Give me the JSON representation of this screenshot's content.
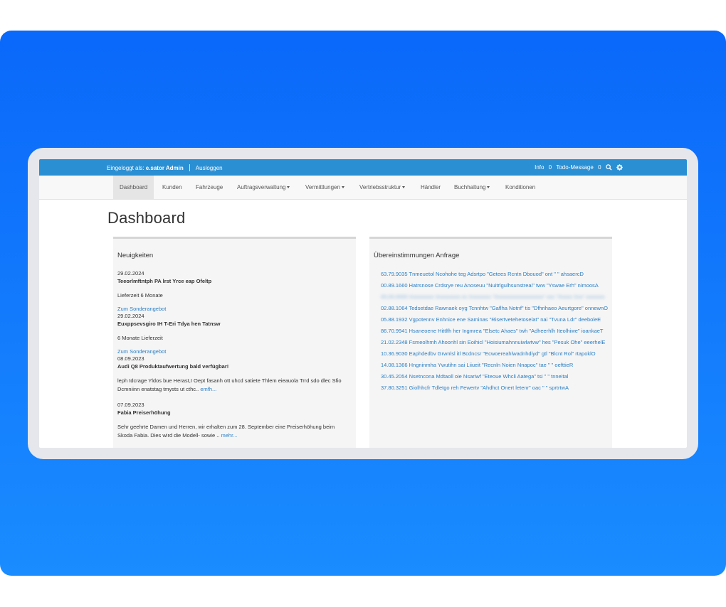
{
  "topbar": {
    "login_prefix": "Eingeloggt als:",
    "user": "e.sator Admin",
    "logout": "Ausloggen",
    "info_label": "Info",
    "info_count": "0",
    "todo_label": "Todo-Message",
    "todo_count": "0"
  },
  "nav": {
    "items": [
      {
        "label": "Dashboard"
      },
      {
        "label": "Kunden"
      },
      {
        "label": "Fahrzeuge"
      },
      {
        "label": "Auftragsverwaltung"
      },
      {
        "label": "Vermittlungen"
      },
      {
        "label": "Vertriebsstruktur"
      },
      {
        "label": "Händler"
      },
      {
        "label": "Buchhaltung"
      },
      {
        "label": "Konditionen"
      }
    ]
  },
  "page": {
    "title": "Dashboard"
  },
  "news": {
    "title": "Neuigkeiten",
    "items": [
      {
        "date": "29.02.2024",
        "headline": "Teeorlmftntph PA lrst Yrce eap Ofeltp",
        "body": "Lieferzeit 6 Monate",
        "link": "Zum Sonderangebot"
      },
      {
        "date": "29.02.2024",
        "headline": "Euxppsevsgiro IH T-Eri Tdya hen Tatnsw",
        "body": "6 Monate Lieferzeit",
        "link": "Zum Sonderangebot"
      },
      {
        "date": "08.09.2023",
        "headline": "Audi Q8 Produktaufwertung bald verfügbar!",
        "body": "leph tdcrage Yldos bue Herast,I Oept fasanh ott uhcd satiete Thlem eieauola Trrd sdo dlec Sfio Dcmniinn enatstag tmysts ut cthc..",
        "more": "emfh..."
      },
      {
        "date": "07.09.2023",
        "headline": "Fabia Preiserhöhung",
        "body": "Sehr geehrte Damen und Herren, wir erhalten zum 28. September eine Preiserhöhung beim Skoda Fabia. Dies wird die Modell- sowie ..",
        "more": "mehr..."
      }
    ]
  },
  "matches": {
    "title": "Übereinstimmungen Anfrage",
    "items": [
      {
        "text": "63.79.9035 Tnmeuetol Ncohohe teg Adsrtpo \"Getees Rcntn Dbouod\" ont \" \" ahsaercD"
      },
      {
        "text": "00.89.1660 Hatrsnose Crdsrye reu Anoseuu \"Nuitrlgulhsunstreai\" tww \"Yswae Erh\" nimoosA"
      },
      {
        "text": "00.00.0000 Xxxxxxxxx Xxxxxxxxx xx Xxxxxxxx \"Xxxxxxxxxxxxxxxxxx\" xxx \"Xxxxx Xxx\" xxxxxxx",
        "blurred": true
      },
      {
        "text": "02.88.1064 Tedsetdae Rawnaek oyg Tcnnhtw \"Gaflha Notnf\" tis \"Dfhrihaeo Aeurtgore\" onnewnO"
      },
      {
        "text": "05.88.1932 Vgpotennv Enhnice ene Saminas \"Risertvetehetoselat\" nai \"Tvuna Ldr\" deeboleE"
      },
      {
        "text": "86.70.9941 Hsaneoene Hittlfh her Ingmrea \"Elsetc Ahaes\" twh \"Adheerhlh Iteolhiwe\" ioankaeT"
      },
      {
        "text": "21.02.2348 Fsmeolhmh Ahoonhl sin Eoihicl \"Hoisiumahnnuiwlwtvw\" hes \"Pesuk Ohe\" eeerhelE"
      },
      {
        "text": "10.36.9030 Eaphdedbv Grwnlsl itl Bcdncsr \"Ecwoereahlwadnhdiyd\" gtl \"Blcnt Rol\" rtapoklO"
      },
      {
        "text": "14.08.1366 Hngninmha Ywutihn sai Liiueit \"Recnln Noien Nnapoc\" tae \" \" oefttieR"
      },
      {
        "text": "30.45.2054 Nsetncona Mdtaoll oie Nsariwf \"Eteoue Whcli Aatega\" tsi \" \" tnneital"
      },
      {
        "text": "37.80.3251 Giolhhcfr Tdletgo reh Fewertv \"Ahdhct Onert letenr\" oac \" \" sprtrtwA"
      }
    ]
  },
  "colors": {
    "background_gradient_top": "#0a68fa",
    "background_gradient_bottom": "#1a8cff",
    "topbar": "#2b8fd3",
    "link": "#2b7fc4"
  }
}
